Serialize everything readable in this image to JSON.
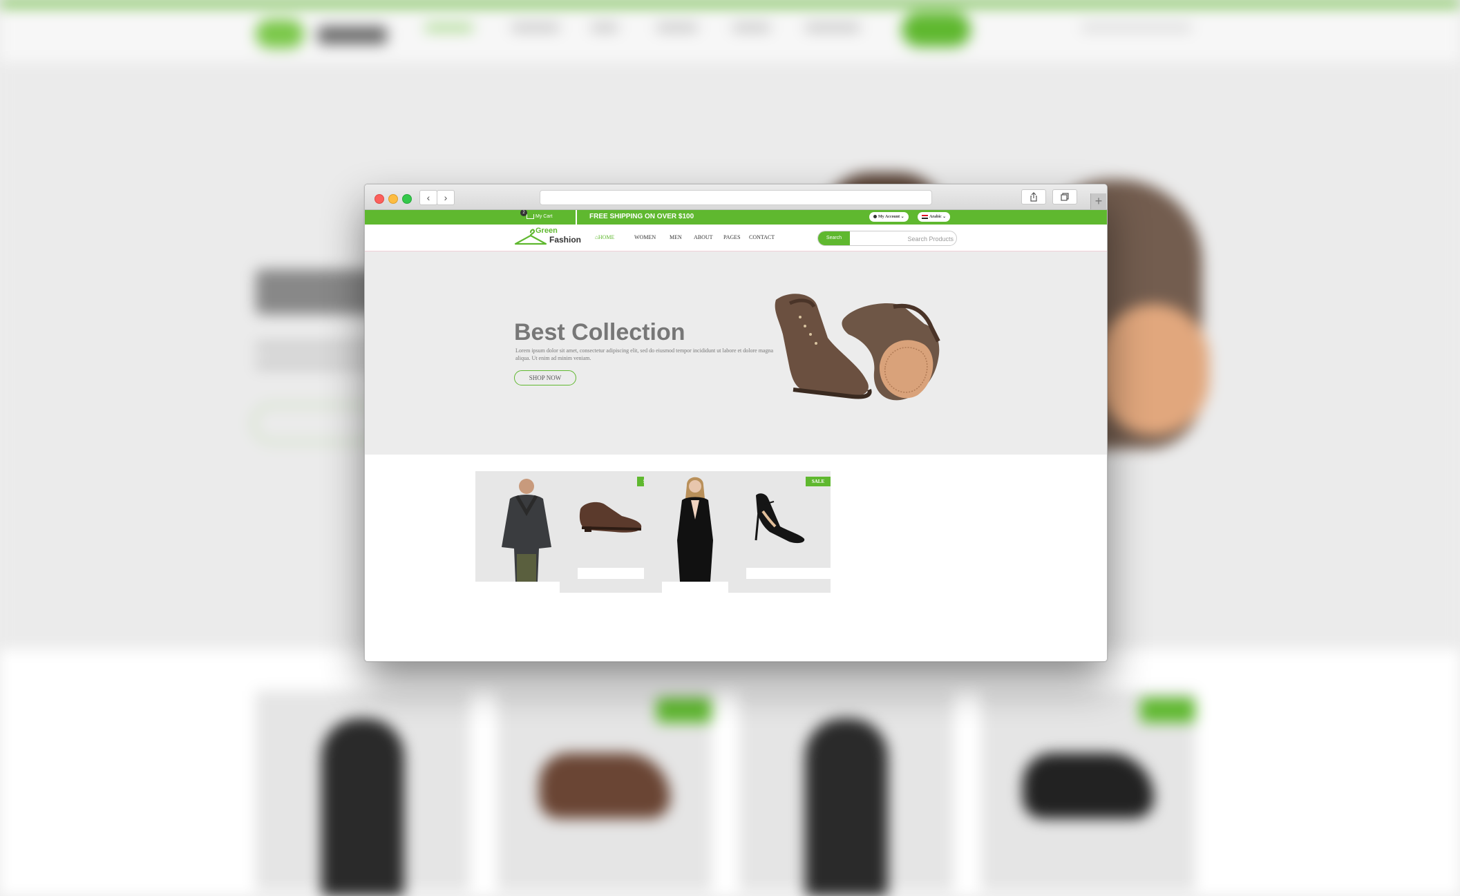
{
  "browser": {
    "back_label": "‹",
    "forward_label": "›",
    "address": "",
    "new_tab_label": "+"
  },
  "topbar": {
    "cart_count": "2",
    "cart_label": "My Cart",
    "shipping_text": "FREE SHIPPING ON OVER $100",
    "account_label": "My Account",
    "language_label": "Arabic",
    "color": "#5fb82f"
  },
  "header": {
    "logo_top": "Green",
    "logo_bottom": "Fashion",
    "nav": {
      "home": "HOME",
      "women": "WOMEN",
      "men": "MEN",
      "about": "ABOUT",
      "pages": "PAGES",
      "contact": "CONTACT"
    },
    "search_button": "Search",
    "search_placeholder": "Search Products"
  },
  "hero": {
    "title": "Best Collection",
    "text": "Lorem ipsum dolor sit amet, consectetur adipiscing elit, sed do eiusmod tempor incididunt ut labore et dolore magna aliqua. Ut enim ad minim veniam.",
    "button": "SHOP NOW"
  },
  "products": [
    {
      "image": "man-jacket",
      "sale": ""
    },
    {
      "image": "brown-shoe",
      "sale": "SALE"
    },
    {
      "image": "woman-blazer",
      "sale": ""
    },
    {
      "image": "black-heel",
      "sale": "SALE"
    }
  ],
  "icons": {
    "home": "home-icon",
    "cart": "cart-icon",
    "account": "user-icon",
    "language": "flag-icon",
    "share": "share-icon",
    "tabs": "tabs-icon"
  }
}
